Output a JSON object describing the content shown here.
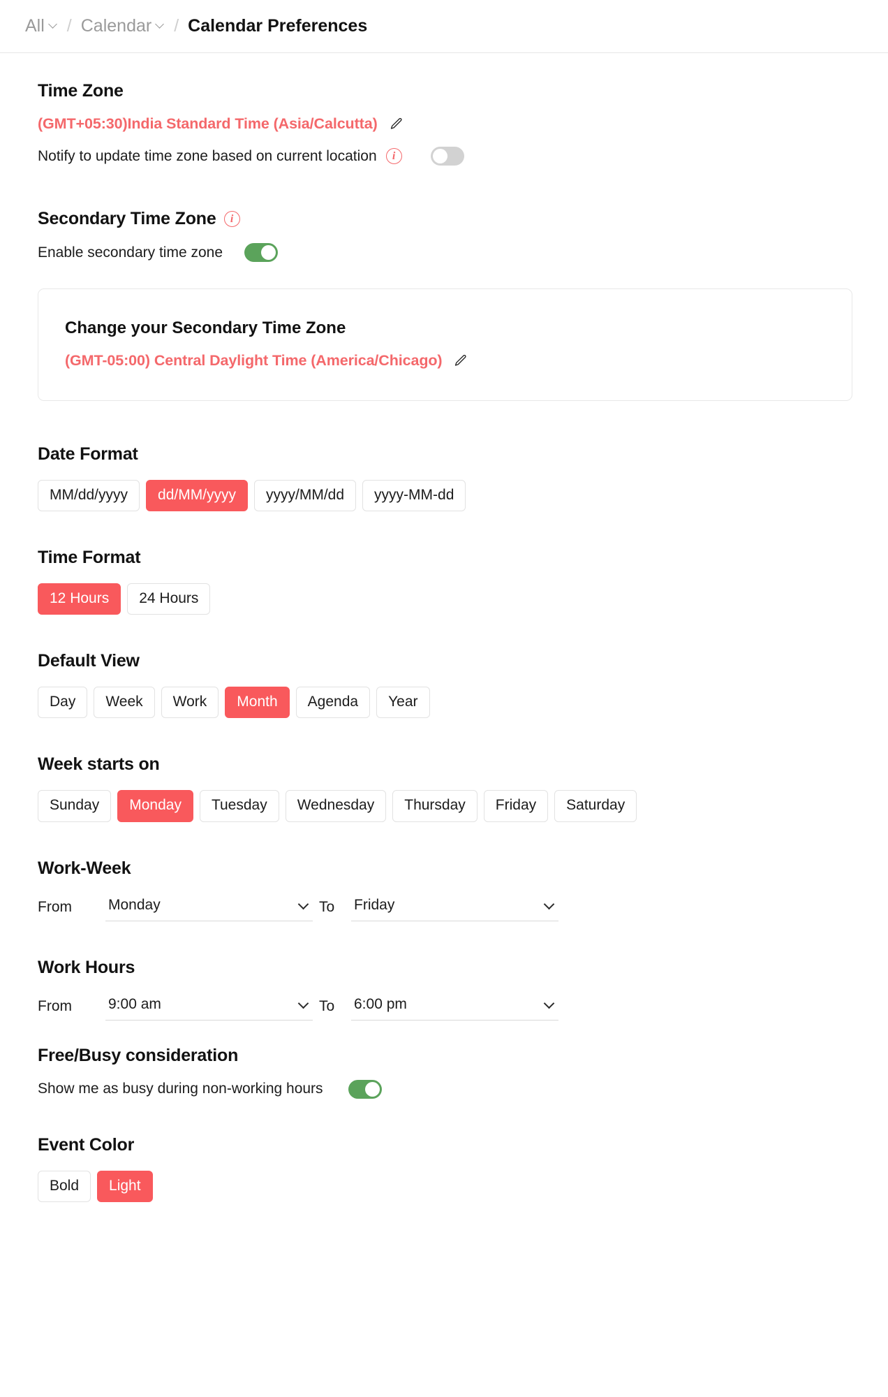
{
  "breadcrumb": {
    "items": [
      {
        "label": "All",
        "has_caret": true,
        "current": false
      },
      {
        "label": "Calendar",
        "has_caret": true,
        "current": false
      },
      {
        "label": "Calendar Preferences",
        "has_caret": false,
        "current": true
      }
    ],
    "separator": "/"
  },
  "colors": {
    "accent_red": "#F9595C",
    "toggle_on_green": "#5BA35B",
    "toggle_off_gray": "#D2D2D2",
    "info_red": "#F4686B"
  },
  "time_zone": {
    "title": "Time Zone",
    "value": "(GMT+05:30)India Standard Time (Asia/Calcutta)",
    "edit_icon": "pencil-icon",
    "notify": {
      "label": "Notify to update time zone based on current location",
      "info_icon": "info-icon",
      "toggle_state": "off"
    }
  },
  "secondary_time_zone": {
    "title": "Secondary Time Zone",
    "info_icon": "info-icon",
    "enable_label": "Enable secondary time zone",
    "enable_toggle_state": "on",
    "card": {
      "title": "Change your Secondary Time Zone",
      "value": "(GMT-05:00) Central Daylight Time (America/Chicago)",
      "edit_icon": "pencil-icon"
    }
  },
  "date_format": {
    "title": "Date Format",
    "options": [
      "MM/dd/yyyy",
      "dd/MM/yyyy",
      "yyyy/MM/dd",
      "yyyy-MM-dd"
    ],
    "selected": "dd/MM/yyyy"
  },
  "time_format": {
    "title": "Time Format",
    "options": [
      "12 Hours",
      "24 Hours"
    ],
    "selected": "12 Hours"
  },
  "default_view": {
    "title": "Default View",
    "options": [
      "Day",
      "Week",
      "Work",
      "Month",
      "Agenda",
      "Year"
    ],
    "selected": "Month"
  },
  "week_starts_on": {
    "title": "Week starts on",
    "options": [
      "Sunday",
      "Monday",
      "Tuesday",
      "Wednesday",
      "Thursday",
      "Friday",
      "Saturday"
    ],
    "selected": "Monday"
  },
  "work_week": {
    "title": "Work-Week",
    "from_label": "From",
    "from_value": "Monday",
    "to_label": "To",
    "to_value": "Friday"
  },
  "work_hours": {
    "title": "Work Hours",
    "from_label": "From",
    "from_value": "9:00 am",
    "to_label": "To",
    "to_value": "6:00 pm"
  },
  "free_busy": {
    "title": "Free/Busy consideration",
    "label": "Show me as busy during non-working hours",
    "toggle_state": "on"
  },
  "event_color": {
    "title": "Event Color",
    "options": [
      "Bold",
      "Light"
    ],
    "selected": "Light"
  }
}
